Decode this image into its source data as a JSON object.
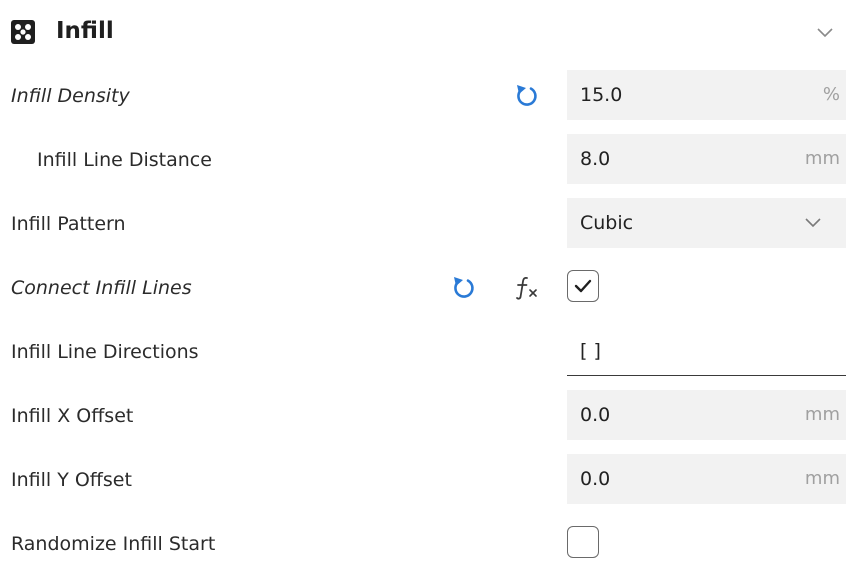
{
  "section": {
    "title": "Infill",
    "icon": "infill-grid-icon",
    "collapse_icon": "chevron-down-icon"
  },
  "settings": [
    {
      "label": "Infill Density",
      "italic": true,
      "value": "15.0",
      "unit": "%",
      "has_reset": true
    },
    {
      "label": "Infill Line Distance",
      "italic": false,
      "value": "8.0",
      "unit": "mm"
    },
    {
      "label": "Infill Pattern",
      "italic": false,
      "value": "Cubic",
      "control": "dropdown"
    },
    {
      "label": "Connect Infill Lines",
      "italic": true,
      "control": "checkbox",
      "checked": true,
      "has_reset": true,
      "has_formula": true
    },
    {
      "label": "Infill Line Directions",
      "italic": false,
      "value": "[ ]",
      "control": "text"
    },
    {
      "label": "Infill X Offset",
      "italic": false,
      "value": "0.0",
      "unit": "mm"
    },
    {
      "label": "Infill Y Offset",
      "italic": false,
      "value": "0.0",
      "unit": "mm"
    },
    {
      "label": "Randomize Infill Start",
      "italic": false,
      "control": "checkbox",
      "checked": false
    }
  ],
  "colors": {
    "accent": "#2a7ad6",
    "field_bg": "#f2f2f2",
    "unit_text": "#a0a0a0",
    "text": "#2b2b2b"
  }
}
